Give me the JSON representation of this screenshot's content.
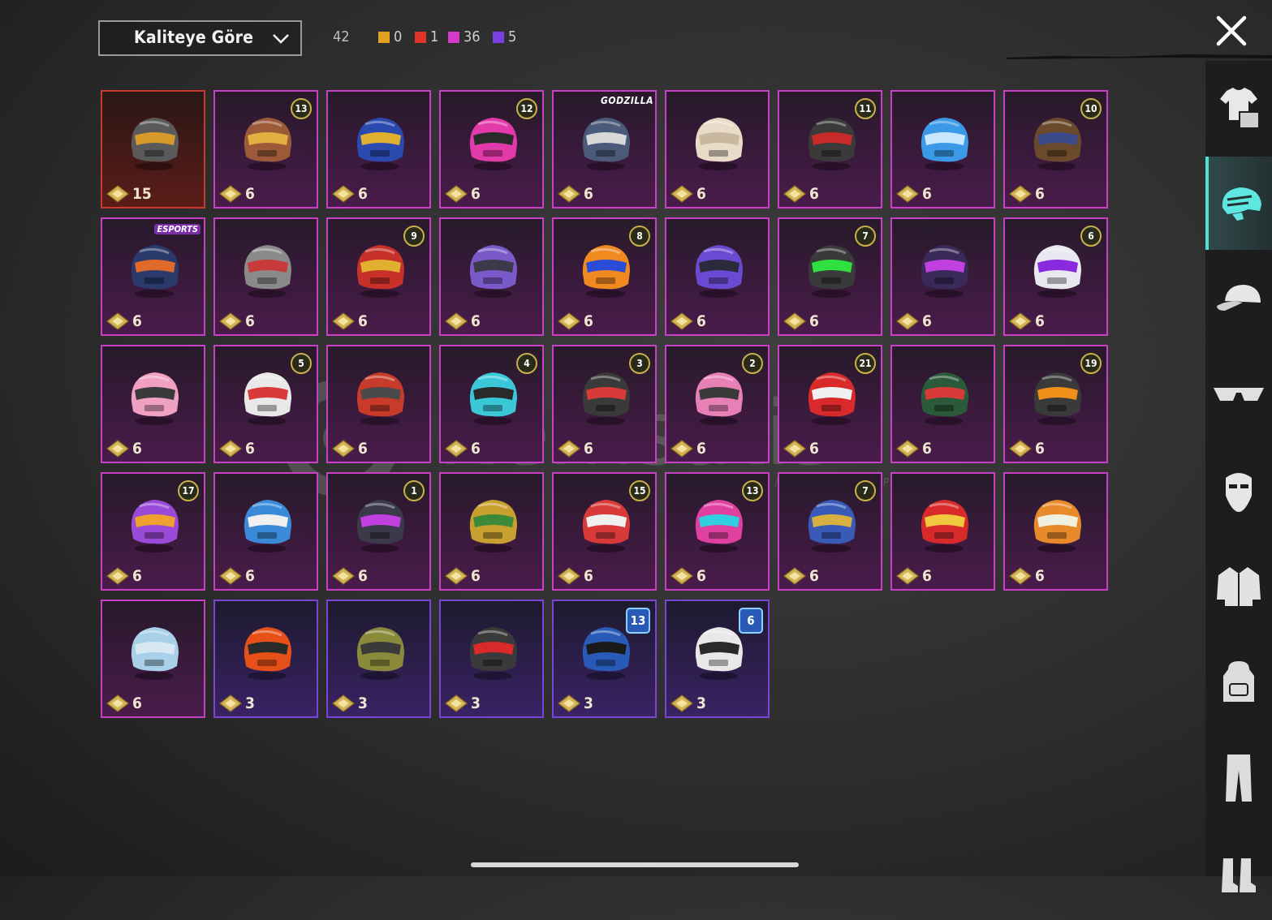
{
  "header": {
    "sort_label": "Kaliteye Göre",
    "total_count": "42",
    "quality_counts": [
      {
        "color": "#e3a121",
        "value": "0"
      },
      {
        "color": "#e0352a",
        "value": "1"
      },
      {
        "color": "#d43ac8",
        "value": "36"
      },
      {
        "color": "#7a3fe0",
        "value": "5"
      }
    ]
  },
  "sidebar": {
    "items": [
      {
        "icon": "shirt-icon",
        "active": false
      },
      {
        "icon": "helmet-icon",
        "active": true
      },
      {
        "icon": "cap-icon",
        "active": false
      },
      {
        "icon": "glasses-icon",
        "active": false
      },
      {
        "icon": "mask-icon",
        "active": false
      },
      {
        "icon": "jacket-icon",
        "active": false
      },
      {
        "icon": "backpack-icon",
        "active": false
      },
      {
        "icon": "pants-icon",
        "active": false
      },
      {
        "icon": "boots-icon",
        "active": false
      }
    ]
  },
  "watermark": {
    "text": "itemsatis",
    "sub": "HESAP / SKIN / ITEM / E-PIN",
    "suffix": ".com"
  },
  "items": [
    {
      "quality": "red",
      "value": "15",
      "badge": "",
      "color": "#5a5a5a",
      "accent": "#d79a2a"
    },
    {
      "quality": "pink",
      "value": "6",
      "badge": "13",
      "color": "#9c5a38",
      "accent": "#e0b040"
    },
    {
      "quality": "pink",
      "value": "6",
      "badge": "",
      "color": "#2a4ab0",
      "accent": "#e2b030"
    },
    {
      "quality": "pink",
      "value": "6",
      "badge": "12",
      "color": "#e23aa8",
      "accent": "#2a2a2a"
    },
    {
      "quality": "pink",
      "value": "6",
      "badge": "",
      "logo": "GODZILLA",
      "color": "#4a5a78",
      "accent": "#d8d8d8"
    },
    {
      "quality": "pink",
      "value": "6",
      "badge": "",
      "color": "#e8dcc8",
      "accent": "#c8b8a0"
    },
    {
      "quality": "pink",
      "value": "6",
      "badge": "11",
      "color": "#3a3a3a",
      "accent": "#c82a2a"
    },
    {
      "quality": "pink",
      "value": "6",
      "badge": "",
      "color": "#3a9ae8",
      "accent": "#c8e8ff"
    },
    {
      "quality": "pink",
      "value": "6",
      "badge": "10",
      "color": "#6a4a2a",
      "accent": "#3a4a8a"
    },
    {
      "quality": "pink",
      "value": "6",
      "badge": "",
      "logo": "ESPORTS",
      "color": "#2a3a6a",
      "accent": "#e06a2a"
    },
    {
      "quality": "pink",
      "value": "6",
      "badge": "",
      "color": "#8a8a8a",
      "accent": "#c83a3a"
    },
    {
      "quality": "pink",
      "value": "6",
      "badge": "9",
      "color": "#c8302a",
      "accent": "#e2b030"
    },
    {
      "quality": "pink",
      "value": "6",
      "badge": "",
      "color": "#7a5ac8",
      "accent": "#3a3a4a"
    },
    {
      "quality": "pink",
      "value": "6",
      "badge": "8",
      "color": "#f08a20",
      "accent": "#2a4ad8"
    },
    {
      "quality": "pink",
      "value": "6",
      "badge": "",
      "color": "#6a4ad0",
      "accent": "#2a2a3a"
    },
    {
      "quality": "pink",
      "value": "6",
      "badge": "7",
      "color": "#3a3a3a",
      "accent": "#30e040"
    },
    {
      "quality": "pink",
      "value": "6",
      "badge": "",
      "color": "#3a2a5a",
      "accent": "#c040e0"
    },
    {
      "quality": "pink",
      "value": "6",
      "badge": "6",
      "color": "#e8e8f0",
      "accent": "#8a2ae0"
    },
    {
      "quality": "pink",
      "value": "6",
      "badge": "",
      "color": "#f0a0c0",
      "accent": "#3a3a3a"
    },
    {
      "quality": "pink",
      "value": "6",
      "badge": "5",
      "color": "#e8e8e8",
      "accent": "#d83a3a"
    },
    {
      "quality": "pink",
      "value": "6",
      "badge": "",
      "color": "#c83a2a",
      "accent": "#4a4a4a"
    },
    {
      "quality": "pink",
      "value": "6",
      "badge": "4",
      "color": "#3ac8d8",
      "accent": "#2a2a2a"
    },
    {
      "quality": "pink",
      "value": "6",
      "badge": "3",
      "color": "#3a3a3a",
      "accent": "#d83a3a"
    },
    {
      "quality": "pink",
      "value": "6",
      "badge": "2",
      "color": "#e880b8",
      "accent": "#3a3a3a"
    },
    {
      "quality": "pink",
      "value": "6",
      "badge": "21",
      "color": "#d82a2a",
      "accent": "#f0f0f0"
    },
    {
      "quality": "pink",
      "value": "6",
      "badge": "",
      "color": "#2a5a3a",
      "accent": "#d83a3a"
    },
    {
      "quality": "pink",
      "value": "6",
      "badge": "19",
      "color": "#3a3a3a",
      "accent": "#f0901a"
    },
    {
      "quality": "pink",
      "value": "6",
      "badge": "17",
      "color": "#9a4ad8",
      "accent": "#f0a030"
    },
    {
      "quality": "pink",
      "value": "6",
      "badge": "",
      "color": "#3a8ad8",
      "accent": "#f0f0f0"
    },
    {
      "quality": "pink",
      "value": "6",
      "badge": "1",
      "color": "#3a3a4a",
      "accent": "#c040e0"
    },
    {
      "quality": "pink",
      "value": "6",
      "badge": "",
      "color": "#c8a030",
      "accent": "#3a8a3a"
    },
    {
      "quality": "pink",
      "value": "6",
      "badge": "15",
      "color": "#d83a3a",
      "accent": "#f0f0f0"
    },
    {
      "quality": "pink",
      "value": "6",
      "badge": "13",
      "color": "#e040a0",
      "accent": "#30d0e0"
    },
    {
      "quality": "pink",
      "value": "6",
      "badge": "7",
      "color": "#3a5ab8",
      "accent": "#d8b040"
    },
    {
      "quality": "pink",
      "value": "6",
      "badge": "",
      "color": "#d82a2a",
      "accent": "#f0c840"
    },
    {
      "quality": "pink",
      "value": "6",
      "badge": "",
      "color": "#e88a2a",
      "accent": "#f0f0e0"
    },
    {
      "quality": "pink",
      "value": "6",
      "badge": "",
      "color": "#a8d0e8",
      "accent": "#d8e8f0"
    },
    {
      "quality": "purple",
      "value": "3",
      "badge": "",
      "color": "#e8501a",
      "accent": "#2a2a2a"
    },
    {
      "quality": "purple",
      "value": "3",
      "badge": "",
      "color": "#8a8a3a",
      "accent": "#3a3a3a"
    },
    {
      "quality": "purple",
      "value": "3",
      "badge": "",
      "color": "#3a3a3a",
      "accent": "#d82a2a"
    },
    {
      "quality": "purple",
      "value": "3",
      "badge": "13",
      "badge_style": "blue",
      "color": "#2a5ab8",
      "accent": "#1a1a1a"
    },
    {
      "quality": "purple",
      "value": "3",
      "badge": "6",
      "badge_style": "blue",
      "color": "#e8e8e8",
      "accent": "#2a2a2a"
    }
  ]
}
